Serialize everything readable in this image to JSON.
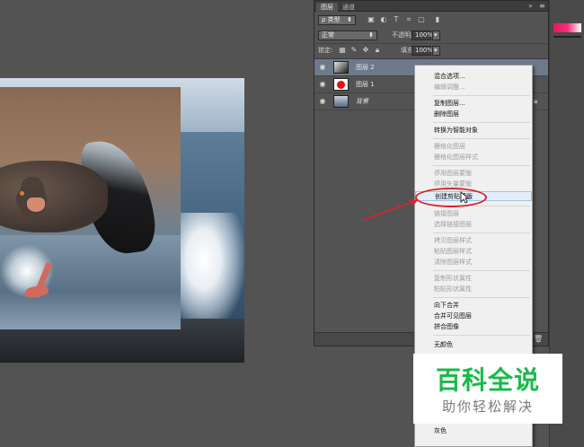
{
  "panel": {
    "tabs": [
      {
        "label": "图层"
      },
      {
        "label": "通道"
      }
    ],
    "filter_label": "ρ 类型",
    "blend_mode": "正常",
    "opacity_label": "不透明度:",
    "opacity_value": "100%",
    "lock_label": "锁定:",
    "fill_label": "填充:",
    "fill_value": "100%",
    "layers": [
      {
        "name": "图层 2",
        "selected": true
      },
      {
        "name": "图层 1",
        "selected": false
      },
      {
        "name": "背景",
        "selected": false
      }
    ]
  },
  "context_menu": {
    "items": [
      {
        "label": "混合选项...",
        "enabled": true
      },
      {
        "label": "编辑调整...",
        "enabled": false
      },
      {
        "label": "复制图层...",
        "enabled": true
      },
      {
        "label": "删除图层",
        "enabled": true
      },
      {
        "label": "转换为智能对象",
        "enabled": true
      },
      {
        "label": "栅格化图层",
        "enabled": false
      },
      {
        "label": "栅格化图层样式",
        "enabled": false
      },
      {
        "label": "停用图层蒙版",
        "enabled": false
      },
      {
        "label": "停用矢量蒙版",
        "enabled": false
      },
      {
        "label": "创建剪贴蒙版",
        "enabled": true,
        "highlighted": true
      },
      {
        "label": "链接图层",
        "enabled": false
      },
      {
        "label": "选择链接图层",
        "enabled": false
      },
      {
        "label": "拷贝图层样式",
        "enabled": false
      },
      {
        "label": "粘贴图层样式",
        "enabled": false
      },
      {
        "label": "清除图层样式",
        "enabled": false
      },
      {
        "label": "复制形状属性",
        "enabled": false
      },
      {
        "label": "粘贴形状属性",
        "enabled": false
      },
      {
        "label": "向下合并",
        "enabled": true
      },
      {
        "label": "合并可见图层",
        "enabled": true
      },
      {
        "label": "拼合图像",
        "enabled": true
      },
      {
        "label": "无颜色",
        "enabled": true
      },
      {
        "label": "灰色",
        "enabled": true
      }
    ]
  },
  "watermark": {
    "title": "百科全说",
    "subtitle": "助你轻松解决"
  },
  "colors": {
    "annotation": "#d9242b",
    "watermark_green": "#1bb94a",
    "selection": "#6c7a8a"
  }
}
